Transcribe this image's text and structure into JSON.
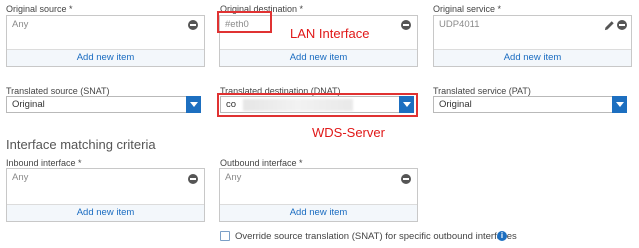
{
  "original": {
    "source": {
      "label": "Original source *",
      "value": "Any",
      "add": "Add new item"
    },
    "destination": {
      "label": "Original destination *",
      "value": "#eth0",
      "add": "Add new item"
    },
    "service": {
      "label": "Original service *",
      "value": "UDP4011",
      "add": "Add new item"
    }
  },
  "translated": {
    "source": {
      "label": "Translated source (SNAT)",
      "value": "Original"
    },
    "destination": {
      "label": "Translated destination (DNAT)",
      "value": "co"
    },
    "service": {
      "label": "Translated service (PAT)",
      "value": "Original"
    }
  },
  "section": {
    "title": "Interface matching criteria"
  },
  "inbound": {
    "label": "Inbound interface *",
    "value": "Any",
    "add": "Add new item"
  },
  "outbound": {
    "label": "Outbound interface *",
    "value": "Any",
    "add": "Add new item"
  },
  "override": {
    "label": "Override source translation (SNAT) for specific outbound interfaces",
    "checked": false
  },
  "annotations": {
    "lan": "LAN Interface",
    "wds": "WDS-Server"
  },
  "colors": {
    "accent": "#1d6fc0",
    "annotation": "#e01818",
    "link": "#1a6cc1"
  },
  "icons": {
    "remove": "minus-circle-icon",
    "edit": "pencil-icon",
    "dropdown": "chevron-down-icon",
    "info": "info-icon"
  }
}
